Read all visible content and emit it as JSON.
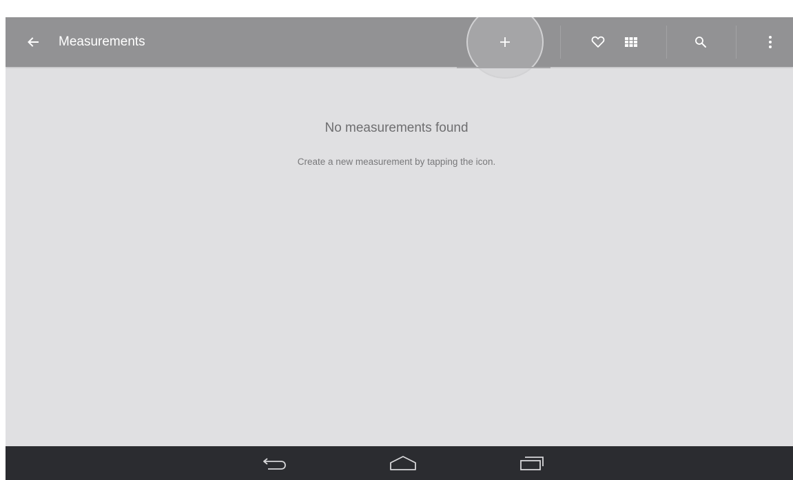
{
  "toolbar": {
    "title": "Measurements",
    "back_icon": "arrow-back-icon",
    "actions": [
      "add-icon",
      "heart-icon",
      "grid-icon",
      "search-icon",
      "overflow-icon"
    ]
  },
  "empty_state": {
    "title": "No measurements found",
    "subtitle": "Create a new measurement by tapping the icon."
  },
  "nav_bar": {
    "buttons": [
      "nav-back-icon",
      "nav-home-icon",
      "nav-recents-icon"
    ]
  },
  "colors": {
    "action_bar": "#929294",
    "background": "#e0e0e2",
    "nav_bar": "#2b2c30",
    "text_primary": "#6e6e70"
  }
}
